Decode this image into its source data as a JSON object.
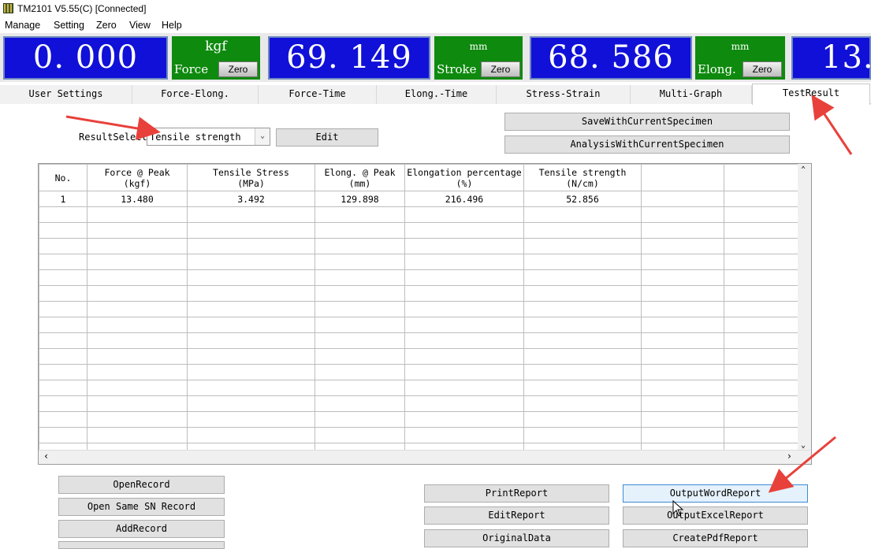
{
  "window": {
    "title": "TM2101 V5.55(C)   [Connected]"
  },
  "menu": [
    "Manage",
    "Setting",
    "Zero",
    "View",
    "Help"
  ],
  "readouts": [
    {
      "value": "0. 000",
      "unit": "kgf",
      "label": "Force",
      "zero": "Zero"
    },
    {
      "value": "69. 149",
      "unit": "mm",
      "label": "Stroke",
      "zero": "Zero"
    },
    {
      "value": "68. 586",
      "unit": "mm",
      "label": "Elong.",
      "zero": "Zero"
    },
    {
      "value": "13."
    }
  ],
  "tabs": [
    "User Settings",
    "Force-Elong.",
    "Force-Time",
    "Elong.-Time",
    "Stress-Strain",
    "Multi-Graph",
    "TestResult"
  ],
  "active_tab": "TestResult",
  "result_select": {
    "label": "ResultSelect",
    "value": "Tensile strength",
    "edit": "Edit"
  },
  "top_buttons": {
    "save": "SaveWithCurrentSpecimen",
    "analysis": "AnalysisWithCurrentSpecimen"
  },
  "table": {
    "headers": [
      [
        "No.",
        ""
      ],
      [
        "Force @ Peak",
        "(kgf)"
      ],
      [
        "Tensile Stress",
        "(MPa)"
      ],
      [
        "Elong. @ Peak",
        "(mm)"
      ],
      [
        "Elongation percentage",
        "(%)"
      ],
      [
        "Tensile strength",
        "(N/cm)"
      ],
      [
        "",
        ""
      ],
      [
        "",
        ""
      ]
    ],
    "rows": [
      [
        "1",
        "13.480",
        "3.492",
        "129.898",
        "216.496",
        "52.856",
        "",
        ""
      ]
    ]
  },
  "left_buttons": [
    "OpenRecord",
    "Open Same SN Record",
    "AddRecord"
  ],
  "report_buttons": {
    "print": "PrintReport",
    "edit": "EditReport",
    "original": "OriginalData",
    "word": "OutputWordReport",
    "excel": "OutputExcelReport",
    "pdf": "CreatePdfReport"
  },
  "colors": {
    "display_bg": "#1010d8",
    "unit_bg": "#0e8a0e",
    "arrow": "#e8413b"
  }
}
